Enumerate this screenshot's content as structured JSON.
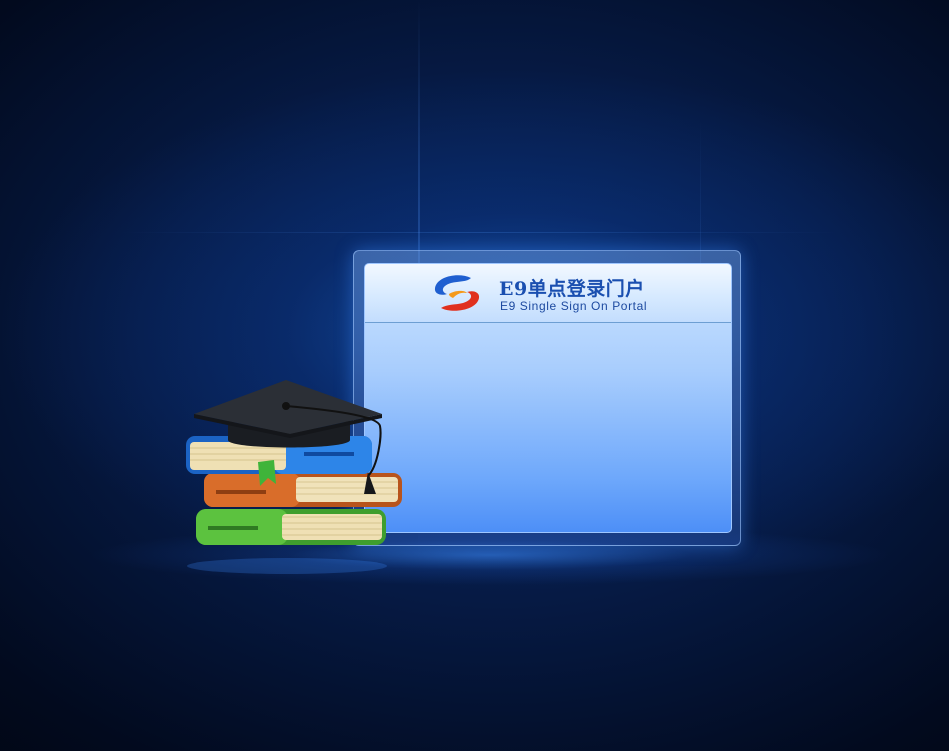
{
  "portal": {
    "title_cn": "E9单点登录门户",
    "title_en": "E9 Single Sign On Portal",
    "logo_icon": "swirl-logo-icon"
  },
  "decor": {
    "illustration_icon": "graduation-cap-books-icon"
  },
  "colors": {
    "background": "#061a44",
    "panel_top": "#cfe6ff",
    "panel_bottom": "#4d8ff7",
    "title": "#1a4fb0",
    "logo_blue": "#1f5fd0",
    "logo_red": "#e0301e",
    "logo_orange": "#f59a1a"
  }
}
